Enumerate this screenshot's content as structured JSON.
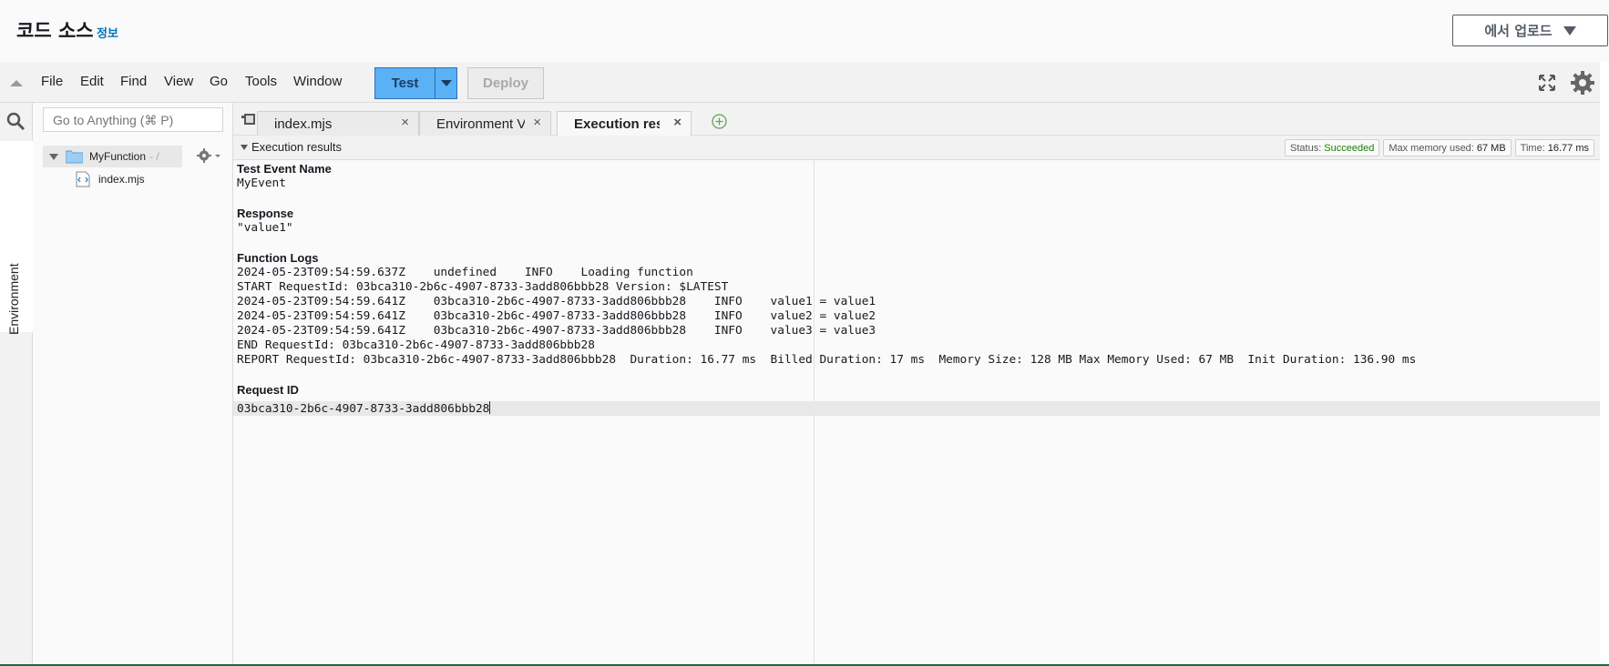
{
  "header": {
    "title": "코드 소스",
    "info_link": "정보",
    "upload_button": "에서 업로드"
  },
  "menubar": {
    "items": [
      "File",
      "Edit",
      "Find",
      "View",
      "Go",
      "Tools",
      "Window"
    ],
    "test_button": "Test",
    "deploy_button": "Deploy"
  },
  "sidebar": {
    "env_tab": "Environment",
    "search_placeholder": "Go to Anything (⌘ P)",
    "folder_name": "MyFunction",
    "folder_path": "- /",
    "file_name": "index.mjs"
  },
  "tabs": [
    {
      "label": "index.mjs",
      "active": false
    },
    {
      "label": "Environment Var",
      "active": false
    },
    {
      "label": "Execution results",
      "active": true
    }
  ],
  "results": {
    "panel_title": "Execution results",
    "status_label": "Status:",
    "status_value": "Succeeded",
    "memory_label": "Max memory used:",
    "memory_value": "67 MB",
    "time_label": "Time:",
    "time_value": "16.77 ms",
    "test_event_heading": "Test Event Name",
    "test_event_value": "MyEvent",
    "response_heading": "Response",
    "response_value": "\"value1\"",
    "logs_heading": "Function Logs",
    "log_lines": [
      "2024-05-23T09:54:59.637Z\tundefined\tINFO\tLoading function",
      "START RequestId: 03bca310-2b6c-4907-8733-3add806bbb28 Version: $LATEST",
      "2024-05-23T09:54:59.641Z\t03bca310-2b6c-4907-8733-3add806bbb28\tINFO\tvalue1 = value1",
      "2024-05-23T09:54:59.641Z\t03bca310-2b6c-4907-8733-3add806bbb28\tINFO\tvalue2 = value2",
      "2024-05-23T09:54:59.641Z\t03bca310-2b6c-4907-8733-3add806bbb28\tINFO\tvalue3 = value3",
      "END RequestId: 03bca310-2b6c-4907-8733-3add806bbb28",
      "REPORT RequestId: 03bca310-2b6c-4907-8733-3add806bbb28  Duration: 16.77 ms  Billed Duration: 17 ms  Memory Size: 128 MB Max Memory Used: 67 MB  Init Duration: 136.90 ms"
    ],
    "request_id_heading": "Request ID",
    "request_id_value": "03bca310-2b6c-4907-8733-3add806bbb28"
  }
}
